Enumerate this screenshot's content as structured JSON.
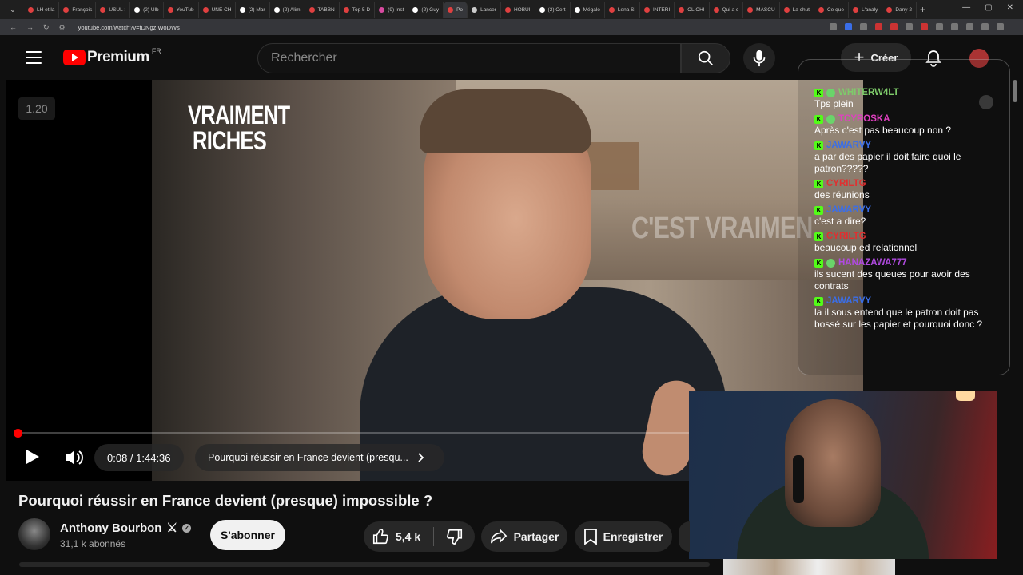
{
  "browser": {
    "tabs": [
      {
        "label": "LH et la",
        "color": "#e04040"
      },
      {
        "label": "François",
        "color": "#e04040"
      },
      {
        "label": "USUL :",
        "color": "#e04040"
      },
      {
        "label": "(2) Ulb",
        "color": "#ffffff"
      },
      {
        "label": "YouTub",
        "color": "#e04040"
      },
      {
        "label": "UNE CH",
        "color": "#e04040"
      },
      {
        "label": "(2) Mar",
        "color": "#ffffff"
      },
      {
        "label": "(2) Alim",
        "color": "#ffffff"
      },
      {
        "label": "TABBN",
        "color": "#e04040"
      },
      {
        "label": "Top 5 D",
        "color": "#e04040"
      },
      {
        "label": "(9) Inst",
        "color": "#d84aa0"
      },
      {
        "label": "(2) Guy",
        "color": "#ffffff"
      },
      {
        "label": "Po",
        "color": "#e04040"
      },
      {
        "label": "Lancer",
        "color": "#cccccc"
      },
      {
        "label": "HOBUI",
        "color": "#e04040"
      },
      {
        "label": "(2) Cert",
        "color": "#ffffff"
      },
      {
        "label": "Mégalo",
        "color": "#ffffff"
      },
      {
        "label": "Lena Si",
        "color": "#e04040"
      },
      {
        "label": "INTERI",
        "color": "#e04040"
      },
      {
        "label": "CLICHI",
        "color": "#e04040"
      },
      {
        "label": "Qui a c",
        "color": "#e04040"
      },
      {
        "label": "MASCU",
        "color": "#e04040"
      },
      {
        "label": "La chut",
        "color": "#e04040"
      },
      {
        "label": "Ce que",
        "color": "#e04040"
      },
      {
        "label": "L'analy",
        "color": "#e04040"
      },
      {
        "label": "Dany 2",
        "color": "#e04040"
      }
    ],
    "active_tab_index": 12,
    "new_tab_label": "+",
    "window_controls": [
      "⌄",
      "—",
      "▢",
      "✕"
    ],
    "url": "youtube.com/watch?v=fDNgzIWoDWs",
    "nav": [
      "←",
      "→",
      "↻"
    ]
  },
  "header": {
    "logo_text": "Premium",
    "country": "FR",
    "search_placeholder": "Rechercher",
    "create_label": "Créer",
    "create_icon": "+"
  },
  "player": {
    "speed": "1.20",
    "overlay_text_1": "VRAIMENT RICHES",
    "overlay_text_2": "C'EST VRAIMEN",
    "time": "0:08 / 1:44:36",
    "chapter": "Pourquoi réussir en France devient (presqu...",
    "progress_fraction": 0.0013
  },
  "chat": {
    "messages": [
      {
        "user": "WHITERW4LT",
        "color": "#7ecb6a",
        "badges": [
          "k",
          "alien"
        ],
        "text": "Tps plein"
      },
      {
        "user": "TCYROSKA",
        "color": "#e040c0",
        "badges": [
          "k",
          "alien"
        ],
        "text": "Après c'est pas beaucoup non ?"
      },
      {
        "user": "JAWARVY",
        "color": "#3a6ee8",
        "badges": [
          "k"
        ],
        "text": "a par des papier il doit faire quoi le patron?????"
      },
      {
        "user": "CYRILTG",
        "color": "#e03030",
        "badges": [
          "k"
        ],
        "text": "des réunions"
      },
      {
        "user": "JAWARVY",
        "color": "#3a6ee8",
        "badges": [
          "k"
        ],
        "text": "c'est a dire?"
      },
      {
        "user": "CYRILTG",
        "color": "#e03030",
        "badges": [
          "k"
        ],
        "text": "beaucoup ed relationnel"
      },
      {
        "user": "HANAZAWA777",
        "color": "#b04ae0",
        "badges": [
          "k",
          "alien"
        ],
        "text": "ils sucent des queues pour avoir des contrats"
      },
      {
        "user": "JAWARVY",
        "color": "#3a6ee8",
        "badges": [
          "k"
        ],
        "text": "la il sous entend que le patron doit pas bossé sur les papier et pourquoi donc ?"
      }
    ]
  },
  "video": {
    "title": "Pourquoi réussir en France devient (presque) impossible ?",
    "channel": "Anthony Bourbon",
    "channel_emoji": "⚔",
    "verified": "✓",
    "subscribers": "31,1 k abonnés",
    "subscribe_label": "S'abonner",
    "likes": "5,4 k",
    "share_label": "Partager",
    "save_label": "Enregistrer"
  },
  "colors": {
    "accent": "#ff0000",
    "background": "#0f0f0f",
    "kick_green": "#53fc18"
  }
}
